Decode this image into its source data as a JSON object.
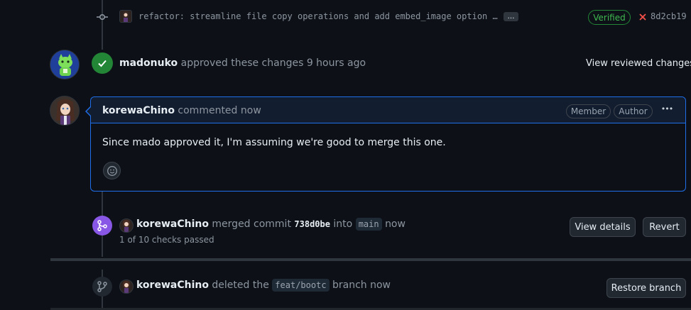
{
  "commit": {
    "message": "refactor: streamline file copy operations and add embed_image option …",
    "ellipsis_label": "…",
    "verified_label": "Verified",
    "sha": "8d2cb19",
    "status_color": "#f85149"
  },
  "approval": {
    "user": "madonuko",
    "text": "approved these changes 9 hours ago",
    "link_label": "View reviewed changes",
    "icon": "check-icon",
    "color": "#238636"
  },
  "comment": {
    "author": "korewaChino",
    "action": "commented now",
    "badges": [
      "Member",
      "Author"
    ],
    "body": "Since mado approved it, I'm assuming we're good to merge this one.",
    "menu_label": "•••"
  },
  "merge": {
    "user": "korewaChino",
    "text_before": "merged commit",
    "commit": "738d0be",
    "text_into": "into",
    "branch": "main",
    "time": "now",
    "checks": "1 of 10 checks passed",
    "view_details_label": "View details",
    "revert_label": "Revert",
    "color": "#8957e5"
  },
  "deleted": {
    "user": "korewaChino",
    "text_before": "deleted the",
    "branch": "feat/bootc",
    "text_after": "branch now",
    "restore_label": "Restore branch"
  }
}
